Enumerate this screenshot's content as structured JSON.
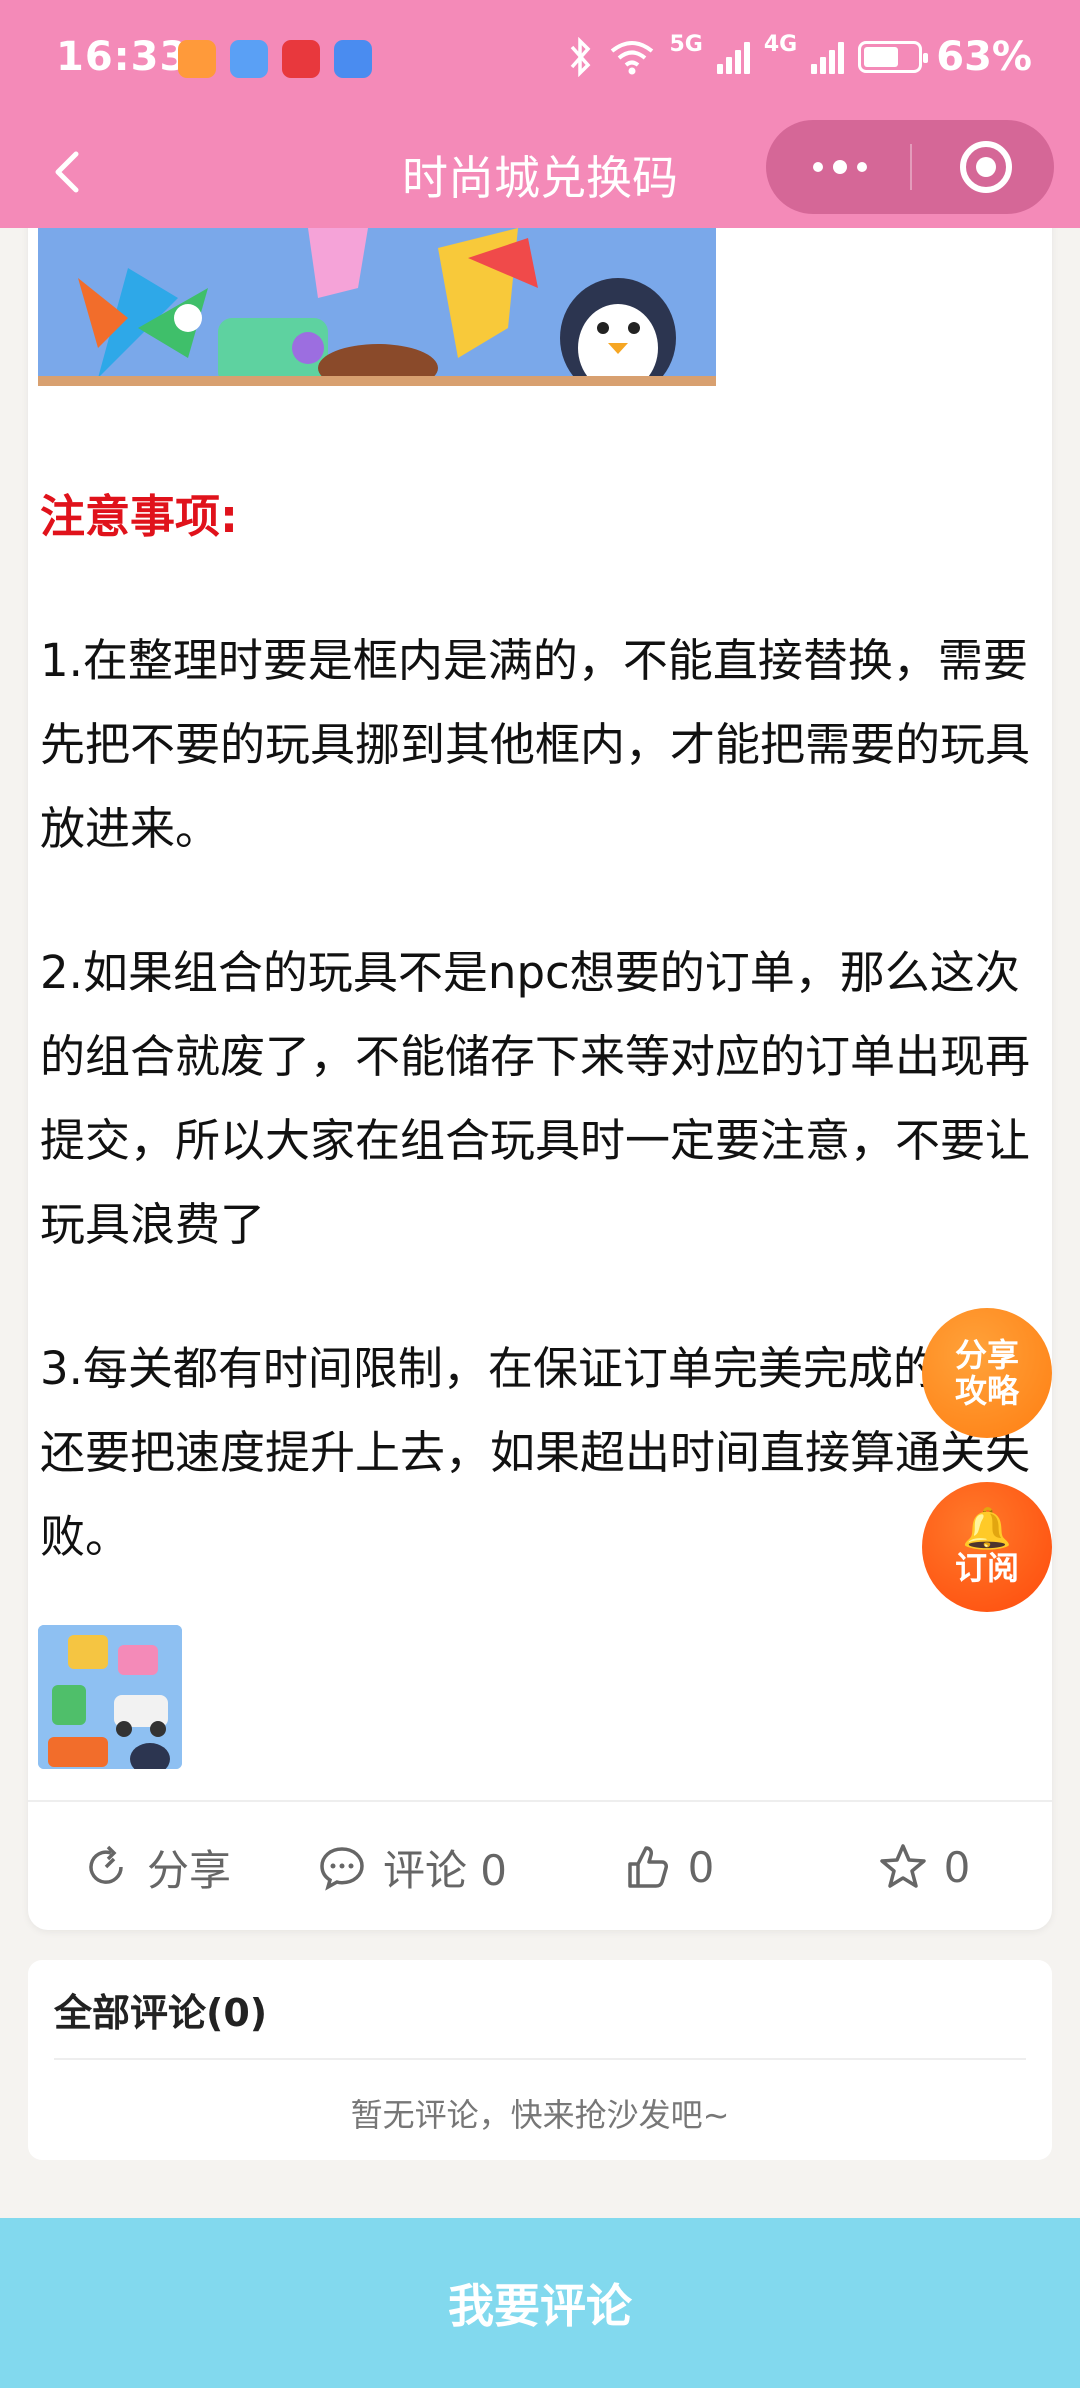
{
  "status_bar": {
    "time": "16:33",
    "network_1": "5G",
    "network_2": "4G",
    "battery": "63%"
  },
  "nav": {
    "title": "时尚城兑换码"
  },
  "article": {
    "notice_heading": "注意事项:",
    "paragraphs": [
      "1.在整理时要是框内是满的，不能直接替换，需要先把不要的玩具挪到其他框内，才能把需要的玩具放进来。",
      "2.如果组合的玩具不是npc想要的订单，那么这次的组合就废了，不能储存下来等对应的订单出现再提交，所以大家在组合玩具时一定要注意，不要让玩具浪费了",
      "3.每关都有时间限制，在保证订单完美完成的同时还要把速度提升上去，如果超出时间直接算通关失败。"
    ]
  },
  "actions": {
    "share": "分享",
    "comment": "评论 0",
    "like": "0",
    "favorite": "0"
  },
  "floating": {
    "share_line1": "分享",
    "share_line2": "攻略",
    "subscribe": "订阅"
  },
  "comments": {
    "title": "全部评论(0)",
    "empty": "暂无评论，快来抢沙发吧~"
  },
  "bottom": {
    "button": "我要评论"
  },
  "colors": {
    "header": "#f48ab8",
    "notice": "#e0121b",
    "float_orange": "#ff7e12",
    "bottom_button": "#82d9ee"
  }
}
